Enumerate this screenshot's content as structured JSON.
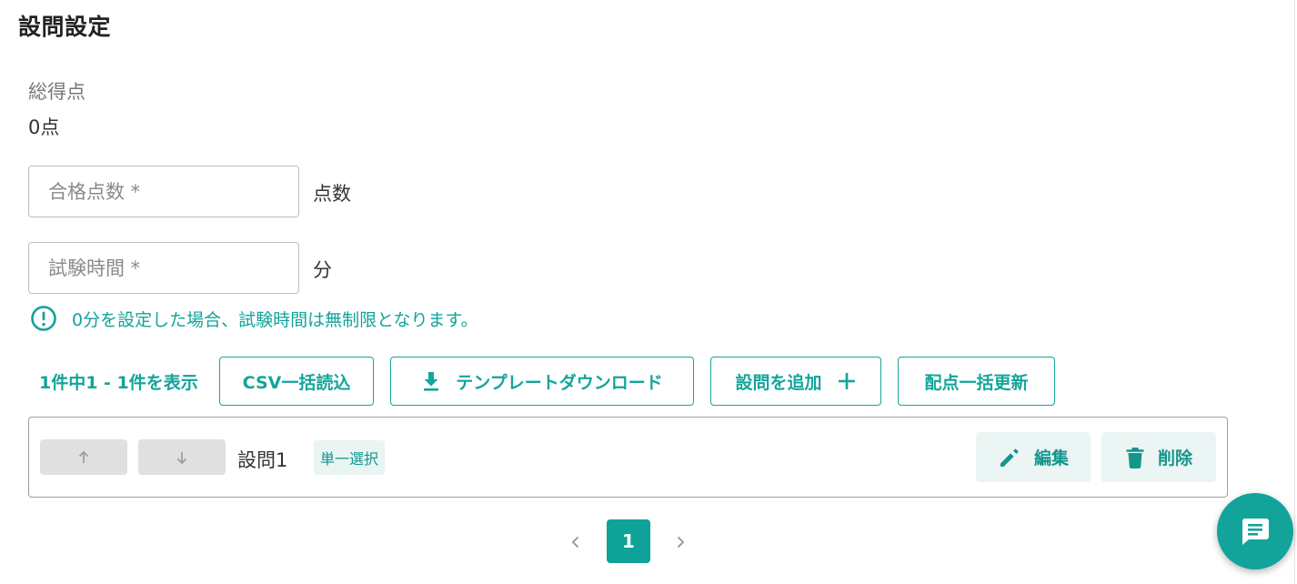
{
  "page": {
    "title": "設問設定"
  },
  "summary": {
    "total_label": "総得点",
    "total_value": "0点"
  },
  "form": {
    "passing_score": {
      "placeholder": "合格点数 *",
      "value": "",
      "unit": "点数"
    },
    "exam_time": {
      "placeholder": "試験時間 *",
      "value": "",
      "unit": "分"
    },
    "notice": "0分を設定した場合、試験時間は無制限となります。"
  },
  "toolbar": {
    "count_text": "1件中1 - 1件を表示",
    "csv_import_label": "CSV一括読込",
    "template_download_label": "テンプレートダウンロード",
    "add_question_label": "設問を追加",
    "bulk_score_update_label": "配点一括更新"
  },
  "questions": [
    {
      "name": "設問1",
      "type": "単一選択",
      "edit_label": "編集",
      "delete_label": "削除"
    }
  ],
  "pagination": {
    "current_page": "1"
  },
  "icons": {
    "info": "exclamation-circle-icon",
    "download": "download-icon",
    "plus": "plus-icon",
    "arrow_up": "arrow-up-icon",
    "arrow_down": "arrow-down-icon",
    "edit": "pencil-icon",
    "delete": "trash-icon",
    "prev": "chevron-left-icon",
    "next": "chevron-right-icon",
    "chat": "chat-bubble-icon"
  },
  "colors": {
    "accent": "#12a39a",
    "accent_light": "#ebf5f4",
    "disabled": "#e0e0e0",
    "border": "#bdbdbd"
  }
}
